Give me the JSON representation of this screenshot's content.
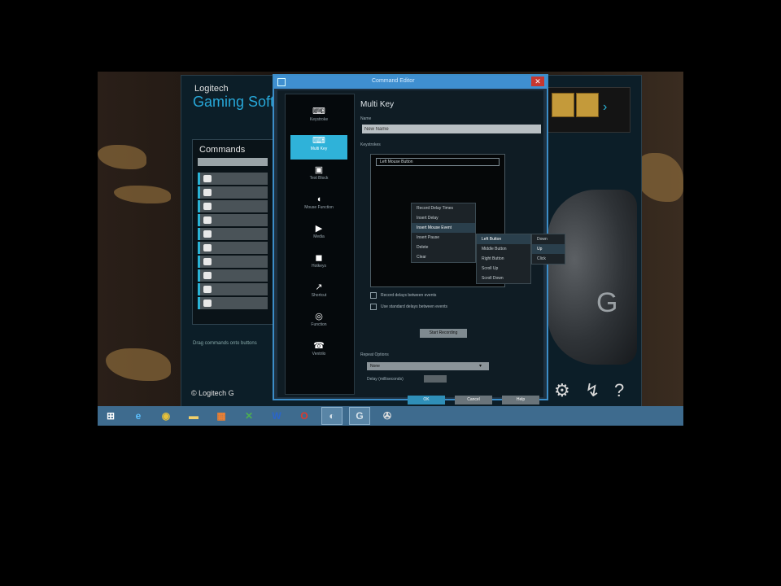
{
  "app": {
    "brand": "Logitech",
    "title": "Gaming Software",
    "footer": "© Logitech G",
    "commands_panel": {
      "title": "Commands",
      "hint": "Drag commands onto buttons"
    },
    "settings_icon": "gear-icon",
    "share_icon": "share-icon",
    "help_icon": "question-icon"
  },
  "dialog": {
    "title": "Command Editor",
    "close_glyph": "✕",
    "heading": "Multi Key",
    "name_label": "Name",
    "name_value": "New Name",
    "record_label": "Keystrokes",
    "record_row": "Left Mouse Button",
    "sidebar": [
      {
        "label": "Keystroke",
        "glyph": "⌨"
      },
      {
        "label": "Multi Key",
        "glyph": "⌨",
        "selected": true
      },
      {
        "label": "Text Block",
        "glyph": "▣"
      },
      {
        "label": "Mouse Function",
        "glyph": "◖"
      },
      {
        "label": "Media",
        "glyph": "▶"
      },
      {
        "label": "Hotkeys",
        "glyph": "◼"
      },
      {
        "label": "Shortcut",
        "glyph": "↗"
      },
      {
        "label": "Function",
        "glyph": "◎"
      },
      {
        "label": "Ventrilo",
        "glyph": "☎"
      }
    ],
    "context_menu": [
      "Record Delay Times",
      "Insert Delay",
      "Insert Mouse Event",
      "Insert Pause",
      "Delete",
      "Clear"
    ],
    "submenu": [
      "Left Button",
      "Middle Button",
      "Right Button",
      "Scroll Up",
      "Scroll Down"
    ],
    "submenu2": [
      "Down",
      "Up",
      "Click"
    ],
    "checkbox1": "Record delays between events",
    "checkbox2": "Use standard delays between events",
    "insert_button": "Start Recording",
    "options_label": "Repeat Options",
    "options_value": "None",
    "delay_label": "Delay (milliseconds)",
    "ok_label": "OK",
    "cancel_label": "Cancel",
    "help_label": "Help"
  },
  "taskbar": {
    "items": [
      {
        "name": "start-button",
        "glyph": "⊞",
        "color": "#ffffff"
      },
      {
        "name": "internet-explorer-icon",
        "glyph": "e",
        "color": "#5bc0ff"
      },
      {
        "name": "chrome-icon",
        "glyph": "◉",
        "color": "#e8c23a"
      },
      {
        "name": "explorer-icon",
        "glyph": "▬",
        "color": "#f2d06b"
      },
      {
        "name": "paint-icon",
        "glyph": "▦",
        "color": "#f08030"
      },
      {
        "name": "excel-icon",
        "glyph": "✕",
        "color": "#4caf50"
      },
      {
        "name": "word-icon",
        "glyph": "W",
        "color": "#2b65c9"
      },
      {
        "name": "opera-icon",
        "glyph": "O",
        "color": "#e0392b"
      },
      {
        "name": "steam-icon",
        "glyph": "◐",
        "color": "#d6e2ea"
      },
      {
        "name": "logitech-gaming-icon",
        "glyph": "G",
        "color": "#d6e2ea"
      },
      {
        "name": "app-icon",
        "glyph": "✇",
        "color": "#e0e0e0"
      }
    ]
  }
}
